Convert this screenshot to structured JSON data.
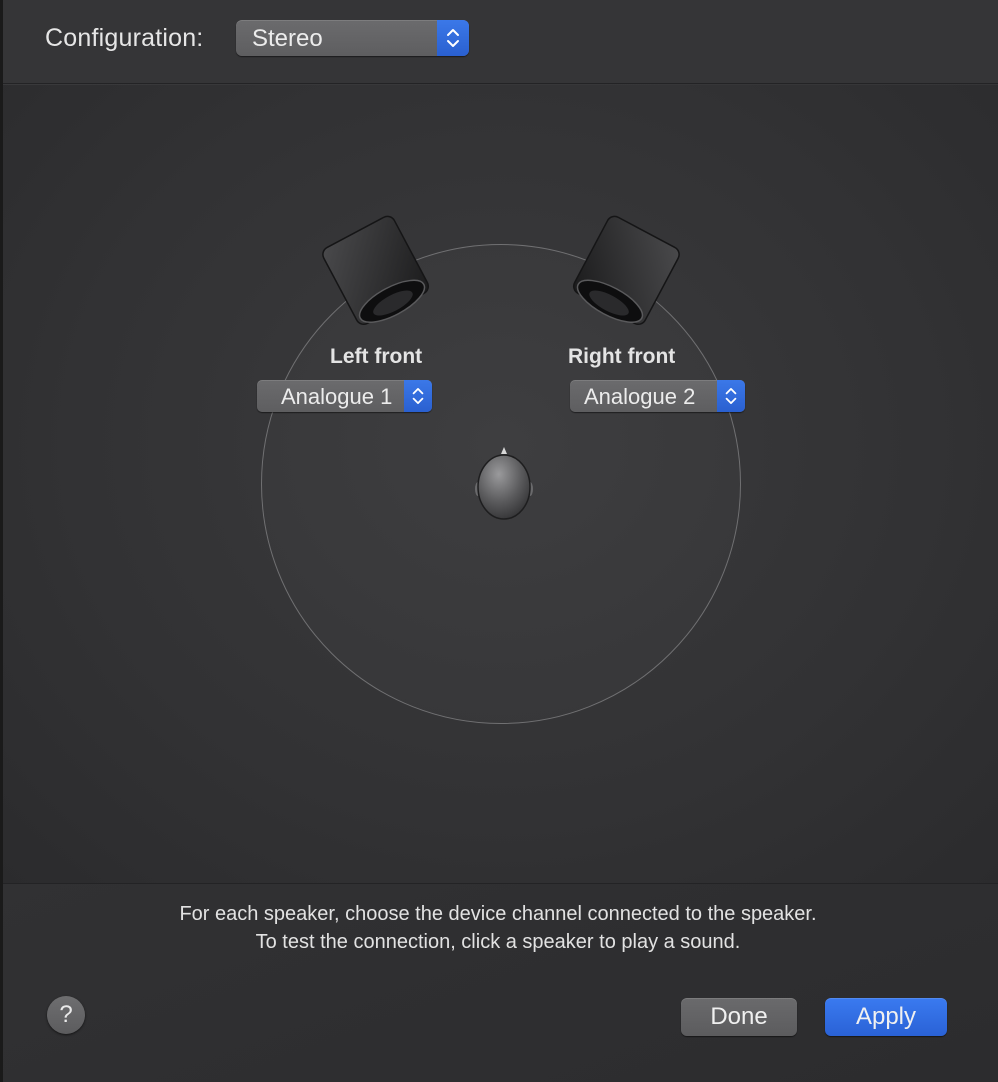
{
  "header": {
    "configuration_label": "Configuration:",
    "configuration_value": "Stereo"
  },
  "speakers": {
    "left": {
      "label": "Left front",
      "channel": "Analogue 1"
    },
    "right": {
      "label": "Right front",
      "channel": "Analogue 2"
    }
  },
  "footer": {
    "instruction_line1": "For each speaker, choose the device channel connected to the speaker.",
    "instruction_line2": "To test the connection, click a speaker to play a sound.",
    "help_label": "?",
    "done_label": "Done",
    "apply_label": "Apply"
  },
  "colors": {
    "accent": "#2f6ee3",
    "background": "#333335",
    "text": "#e4e4e4"
  }
}
